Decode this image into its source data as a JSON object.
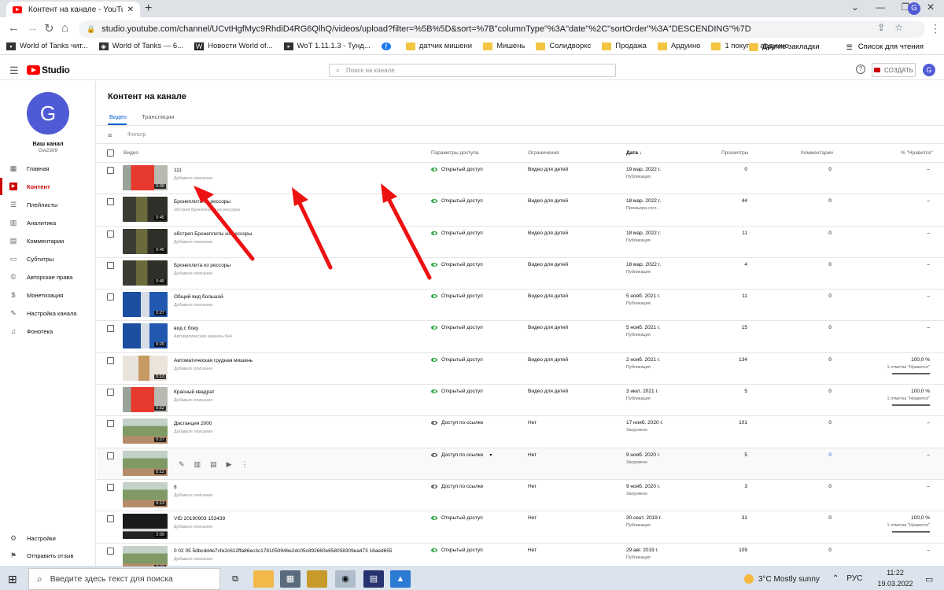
{
  "browser": {
    "tab_title": "Контент на канале - YouTube Studio",
    "url": "studio.youtube.com/channel/UCvtHgfMyc9RhdiD4RG6QlhQ/videos/upload?filter=%5B%5D&sort=%7B\"columnType\"%3A\"date\"%2C\"sortOrder\"%3A\"DESCENDING\"%7D",
    "profile_initial": "G",
    "bookmarks": [
      {
        "label": "World of Tanks чит...",
        "icon": "site-icon"
      },
      {
        "label": "World of Tanks — 6...",
        "icon": "shield-icon"
      },
      {
        "label": "Новости World of...",
        "icon": "w-icon"
      },
      {
        "label": "WoT 1.11.1.3 - Тунд...",
        "icon": "site-icon"
      },
      {
        "label": "",
        "icon": "facebook-icon"
      },
      {
        "label": "датчик мишени",
        "icon": "folder-icon"
      },
      {
        "label": "Мишень",
        "icon": "folder-icon"
      },
      {
        "label": "Солидворкс",
        "icon": "folder-icon"
      },
      {
        "label": "Продажа",
        "icon": "folder-icon"
      },
      {
        "label": "Ардуино",
        "icon": "folder-icon"
      },
      {
        "label": "1 покупка  ардуино",
        "icon": "folder-icon"
      }
    ],
    "other_bookmarks": "Другие закладки",
    "reading_list": "Список для чтения"
  },
  "header": {
    "logo_text": "Studio",
    "search_placeholder": "Поиск на канале",
    "create_label": "СОЗДАТЬ",
    "avatar_initial": "G"
  },
  "sidebar": {
    "avatar_initial": "G",
    "channel_label": "Ваш канал",
    "channel_name": "Gw2309",
    "items": [
      {
        "label": "Главная",
        "icon": "dashboard-icon",
        "active": false
      },
      {
        "label": "Контент",
        "icon": "content-icon",
        "active": true
      },
      {
        "label": "Плейлисты",
        "icon": "playlist-icon",
        "active": false
      },
      {
        "label": "Аналитика",
        "icon": "analytics-icon",
        "active": false
      },
      {
        "label": "Комментарии",
        "icon": "comments-icon",
        "active": false
      },
      {
        "label": "Субтитры",
        "icon": "subtitles-icon",
        "active": false
      },
      {
        "label": "Авторские права",
        "icon": "copyright-icon",
        "active": false
      },
      {
        "label": "Монетизация",
        "icon": "dollar-icon",
        "active": false
      },
      {
        "label": "Настройка канала",
        "icon": "customization-icon",
        "active": false
      },
      {
        "label": "Фонотека",
        "icon": "audio-library-icon",
        "active": false
      }
    ],
    "settings_label": "Настройки",
    "feedback_label": "Отправить отзыв"
  },
  "main": {
    "title": "Контент на канале",
    "tabs": [
      "Видео",
      "Трансляции"
    ],
    "filter_label": "Фильтр",
    "columns": {
      "video": "Видео",
      "visibility": "Параметры доступа",
      "restrictions": "Ограничения",
      "date": "Дата ↓",
      "views": "Просмотры",
      "comments": "Комментарии",
      "likes": "% \"Нравится\""
    },
    "rows": [
      {
        "title": "111",
        "desc": "Добавьте описание",
        "duration": "0:09",
        "thumb": "red",
        "visibility": "Открытый доступ",
        "vis_color": "#2ba640",
        "restriction": "Видео для детей",
        "date": "19 мар. 2022 г.",
        "date_status": "Публикация",
        "views": "0",
        "comments": "0",
        "likes": "–",
        "like_count": ""
      },
      {
        "title": "Бронеплита из рессоры",
        "desc": "обстрел Бронеплиты из рессоры",
        "duration": "0:45",
        "thumb": "dark",
        "visibility": "Открытый доступ",
        "vis_color": "#2ba640",
        "restriction": "Видео для детей",
        "date": "18 мар. 2022 г.",
        "date_status": "Премьера сост...",
        "views": "44",
        "comments": "0",
        "likes": "–",
        "like_count": ""
      },
      {
        "title": "обстрел Бронеплиты из рессоры",
        "desc": "Добавьте описание",
        "duration": "0:45",
        "thumb": "dark",
        "visibility": "Открытый доступ",
        "vis_color": "#2ba640",
        "restriction": "Видео для детей",
        "date": "18 мар. 2022 г.",
        "date_status": "Публикация",
        "views": "11",
        "comments": "0",
        "likes": "–",
        "like_count": ""
      },
      {
        "title": "Бронеплита из рессоры",
        "desc": "Добавьте описание",
        "duration": "0:45",
        "thumb": "dark",
        "visibility": "Открытый доступ",
        "vis_color": "#2ba640",
        "restriction": "Видео для детей",
        "date": "18 мар. 2022 г.",
        "date_status": "Публикация",
        "views": "4",
        "comments": "0",
        "likes": "–",
        "like_count": ""
      },
      {
        "title": "Общий вид большой",
        "desc": "Добавьте описание",
        "duration": "2:27",
        "thumb": "blue",
        "visibility": "Открытый доступ",
        "vis_color": "#2ba640",
        "restriction": "Видео для детей",
        "date": "5 нояб. 2021 г.",
        "date_status": "Публикация",
        "views": "11",
        "comments": "0",
        "likes": "–",
        "like_count": ""
      },
      {
        "title": "вид с боку",
        "desc": "Автоматическая мишень №4",
        "duration": "0:20",
        "thumb": "blue",
        "visibility": "Открытый доступ",
        "vis_color": "#2ba640",
        "restriction": "Видео для детей",
        "date": "5 нояб. 2021 г.",
        "date_status": "Публикация",
        "views": "15",
        "comments": "0",
        "likes": "–",
        "like_count": ""
      },
      {
        "title": "Автоматическая грудная мишень",
        "desc": "Добавьте описание",
        "duration": "0:13",
        "thumb": "wood",
        "visibility": "Открытый доступ",
        "vis_color": "#2ba640",
        "restriction": "Видео для детей",
        "date": "2 нояб. 2021 г.",
        "date_status": "Публикация",
        "views": "134",
        "comments": "0",
        "likes": "100,0 %",
        "like_count": "1 отметка \"Нравится\""
      },
      {
        "title": "Красный квадрат",
        "desc": "Добавьте описание",
        "duration": "0:52",
        "thumb": "red",
        "visibility": "Открытый доступ",
        "vis_color": "#2ba640",
        "restriction": "Видео для детей",
        "date": "3 июл. 2021 г.",
        "date_status": "Публикация",
        "views": "5",
        "comments": "0",
        "likes": "100,0 %",
        "like_count": "1 отметка \"Нравится\""
      },
      {
        "title": "Дистанция 2000",
        "desc": "Добавьте описание",
        "duration": "0:27",
        "thumb": "field",
        "visibility": "Доступ по ссылке",
        "vis_color": "#606060",
        "restriction": "Нет",
        "date": "17 нояб. 2020 г.",
        "date_status": "Загружено",
        "views": "101",
        "comments": "0",
        "likes": "–",
        "like_count": ""
      },
      {
        "title": "",
        "desc": "",
        "duration": "0:12",
        "thumb": "field",
        "visibility": "Доступ по ссылке",
        "vis_color": "#606060",
        "restriction": "Нет",
        "date": "9 нояб. 2020 г.",
        "date_status": "Загружено",
        "views": "5",
        "comments": "0",
        "likes": "–",
        "like_count": "",
        "hover": true
      },
      {
        "title": "8",
        "desc": "Добавьте описание",
        "duration": "0:13",
        "thumb": "field",
        "visibility": "Доступ по ссылке",
        "vis_color": "#606060",
        "restriction": "Нет",
        "date": "9 нояб. 2020 г.",
        "date_status": "Загружено",
        "views": "3",
        "comments": "0",
        "likes": "–",
        "like_count": ""
      },
      {
        "title": "VID 20190903 153439",
        "desc": "Добавьте описание",
        "duration": "2:09",
        "thumb": "night",
        "visibility": "Открытый доступ",
        "vis_color": "#2ba640",
        "restriction": "Нет",
        "date": "30 сент. 2019 г.",
        "date_status": "Публикация",
        "views": "31",
        "comments": "0",
        "likes": "100,0 %",
        "like_count": "1 отметка \"Нравится\""
      },
      {
        "title": "0 02 05 5dbcdd4e7cfe2c612ffa86ec3c1781050946e2dc05c892660e658058309ea473 16aed655",
        "desc": "Добавьте описание",
        "duration": "2:27",
        "thumb": "field",
        "visibility": "Открытый доступ",
        "vis_color": "#2ba640",
        "restriction": "Нет",
        "date": "29 авг. 2019 г.",
        "date_status": "Публикация",
        "views": "109",
        "comments": "0",
        "likes": "–",
        "like_count": ""
      }
    ]
  },
  "taskbar": {
    "search_placeholder": "Введите здесь текст для поиска",
    "weather": "3°C  Mostly sunny",
    "lang": "РУС",
    "time": "11:22",
    "date": "19.03.2022"
  },
  "colors": {
    "accent": "#065fd4",
    "brand": "#ff0000",
    "active": "#cc0000",
    "public": "#2ba640",
    "annotation_arrow": "#ee1111"
  }
}
